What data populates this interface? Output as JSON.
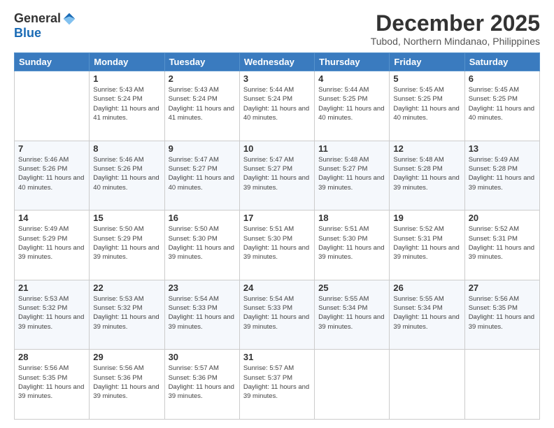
{
  "header": {
    "logo_general": "General",
    "logo_blue": "Blue",
    "month_title": "December 2025",
    "location": "Tubod, Northern Mindanao, Philippines"
  },
  "days_of_week": [
    "Sunday",
    "Monday",
    "Tuesday",
    "Wednesday",
    "Thursday",
    "Friday",
    "Saturday"
  ],
  "weeks": [
    [
      {
        "day": "",
        "sunrise": "",
        "sunset": "",
        "daylight": ""
      },
      {
        "day": "1",
        "sunrise": "Sunrise: 5:43 AM",
        "sunset": "Sunset: 5:24 PM",
        "daylight": "Daylight: 11 hours and 41 minutes."
      },
      {
        "day": "2",
        "sunrise": "Sunrise: 5:43 AM",
        "sunset": "Sunset: 5:24 PM",
        "daylight": "Daylight: 11 hours and 41 minutes."
      },
      {
        "day": "3",
        "sunrise": "Sunrise: 5:44 AM",
        "sunset": "Sunset: 5:24 PM",
        "daylight": "Daylight: 11 hours and 40 minutes."
      },
      {
        "day": "4",
        "sunrise": "Sunrise: 5:44 AM",
        "sunset": "Sunset: 5:25 PM",
        "daylight": "Daylight: 11 hours and 40 minutes."
      },
      {
        "day": "5",
        "sunrise": "Sunrise: 5:45 AM",
        "sunset": "Sunset: 5:25 PM",
        "daylight": "Daylight: 11 hours and 40 minutes."
      },
      {
        "day": "6",
        "sunrise": "Sunrise: 5:45 AM",
        "sunset": "Sunset: 5:25 PM",
        "daylight": "Daylight: 11 hours and 40 minutes."
      }
    ],
    [
      {
        "day": "7",
        "sunrise": "Sunrise: 5:46 AM",
        "sunset": "Sunset: 5:26 PM",
        "daylight": "Daylight: 11 hours and 40 minutes."
      },
      {
        "day": "8",
        "sunrise": "Sunrise: 5:46 AM",
        "sunset": "Sunset: 5:26 PM",
        "daylight": "Daylight: 11 hours and 40 minutes."
      },
      {
        "day": "9",
        "sunrise": "Sunrise: 5:47 AM",
        "sunset": "Sunset: 5:27 PM",
        "daylight": "Daylight: 11 hours and 40 minutes."
      },
      {
        "day": "10",
        "sunrise": "Sunrise: 5:47 AM",
        "sunset": "Sunset: 5:27 PM",
        "daylight": "Daylight: 11 hours and 39 minutes."
      },
      {
        "day": "11",
        "sunrise": "Sunrise: 5:48 AM",
        "sunset": "Sunset: 5:27 PM",
        "daylight": "Daylight: 11 hours and 39 minutes."
      },
      {
        "day": "12",
        "sunrise": "Sunrise: 5:48 AM",
        "sunset": "Sunset: 5:28 PM",
        "daylight": "Daylight: 11 hours and 39 minutes."
      },
      {
        "day": "13",
        "sunrise": "Sunrise: 5:49 AM",
        "sunset": "Sunset: 5:28 PM",
        "daylight": "Daylight: 11 hours and 39 minutes."
      }
    ],
    [
      {
        "day": "14",
        "sunrise": "Sunrise: 5:49 AM",
        "sunset": "Sunset: 5:29 PM",
        "daylight": "Daylight: 11 hours and 39 minutes."
      },
      {
        "day": "15",
        "sunrise": "Sunrise: 5:50 AM",
        "sunset": "Sunset: 5:29 PM",
        "daylight": "Daylight: 11 hours and 39 minutes."
      },
      {
        "day": "16",
        "sunrise": "Sunrise: 5:50 AM",
        "sunset": "Sunset: 5:30 PM",
        "daylight": "Daylight: 11 hours and 39 minutes."
      },
      {
        "day": "17",
        "sunrise": "Sunrise: 5:51 AM",
        "sunset": "Sunset: 5:30 PM",
        "daylight": "Daylight: 11 hours and 39 minutes."
      },
      {
        "day": "18",
        "sunrise": "Sunrise: 5:51 AM",
        "sunset": "Sunset: 5:30 PM",
        "daylight": "Daylight: 11 hours and 39 minutes."
      },
      {
        "day": "19",
        "sunrise": "Sunrise: 5:52 AM",
        "sunset": "Sunset: 5:31 PM",
        "daylight": "Daylight: 11 hours and 39 minutes."
      },
      {
        "day": "20",
        "sunrise": "Sunrise: 5:52 AM",
        "sunset": "Sunset: 5:31 PM",
        "daylight": "Daylight: 11 hours and 39 minutes."
      }
    ],
    [
      {
        "day": "21",
        "sunrise": "Sunrise: 5:53 AM",
        "sunset": "Sunset: 5:32 PM",
        "daylight": "Daylight: 11 hours and 39 minutes."
      },
      {
        "day": "22",
        "sunrise": "Sunrise: 5:53 AM",
        "sunset": "Sunset: 5:32 PM",
        "daylight": "Daylight: 11 hours and 39 minutes."
      },
      {
        "day": "23",
        "sunrise": "Sunrise: 5:54 AM",
        "sunset": "Sunset: 5:33 PM",
        "daylight": "Daylight: 11 hours and 39 minutes."
      },
      {
        "day": "24",
        "sunrise": "Sunrise: 5:54 AM",
        "sunset": "Sunset: 5:33 PM",
        "daylight": "Daylight: 11 hours and 39 minutes."
      },
      {
        "day": "25",
        "sunrise": "Sunrise: 5:55 AM",
        "sunset": "Sunset: 5:34 PM",
        "daylight": "Daylight: 11 hours and 39 minutes."
      },
      {
        "day": "26",
        "sunrise": "Sunrise: 5:55 AM",
        "sunset": "Sunset: 5:34 PM",
        "daylight": "Daylight: 11 hours and 39 minutes."
      },
      {
        "day": "27",
        "sunrise": "Sunrise: 5:56 AM",
        "sunset": "Sunset: 5:35 PM",
        "daylight": "Daylight: 11 hours and 39 minutes."
      }
    ],
    [
      {
        "day": "28",
        "sunrise": "Sunrise: 5:56 AM",
        "sunset": "Sunset: 5:35 PM",
        "daylight": "Daylight: 11 hours and 39 minutes."
      },
      {
        "day": "29",
        "sunrise": "Sunrise: 5:56 AM",
        "sunset": "Sunset: 5:36 PM",
        "daylight": "Daylight: 11 hours and 39 minutes."
      },
      {
        "day": "30",
        "sunrise": "Sunrise: 5:57 AM",
        "sunset": "Sunset: 5:36 PM",
        "daylight": "Daylight: 11 hours and 39 minutes."
      },
      {
        "day": "31",
        "sunrise": "Sunrise: 5:57 AM",
        "sunset": "Sunset: 5:37 PM",
        "daylight": "Daylight: 11 hours and 39 minutes."
      },
      {
        "day": "",
        "sunrise": "",
        "sunset": "",
        "daylight": ""
      },
      {
        "day": "",
        "sunrise": "",
        "sunset": "",
        "daylight": ""
      },
      {
        "day": "",
        "sunrise": "",
        "sunset": "",
        "daylight": ""
      }
    ]
  ]
}
